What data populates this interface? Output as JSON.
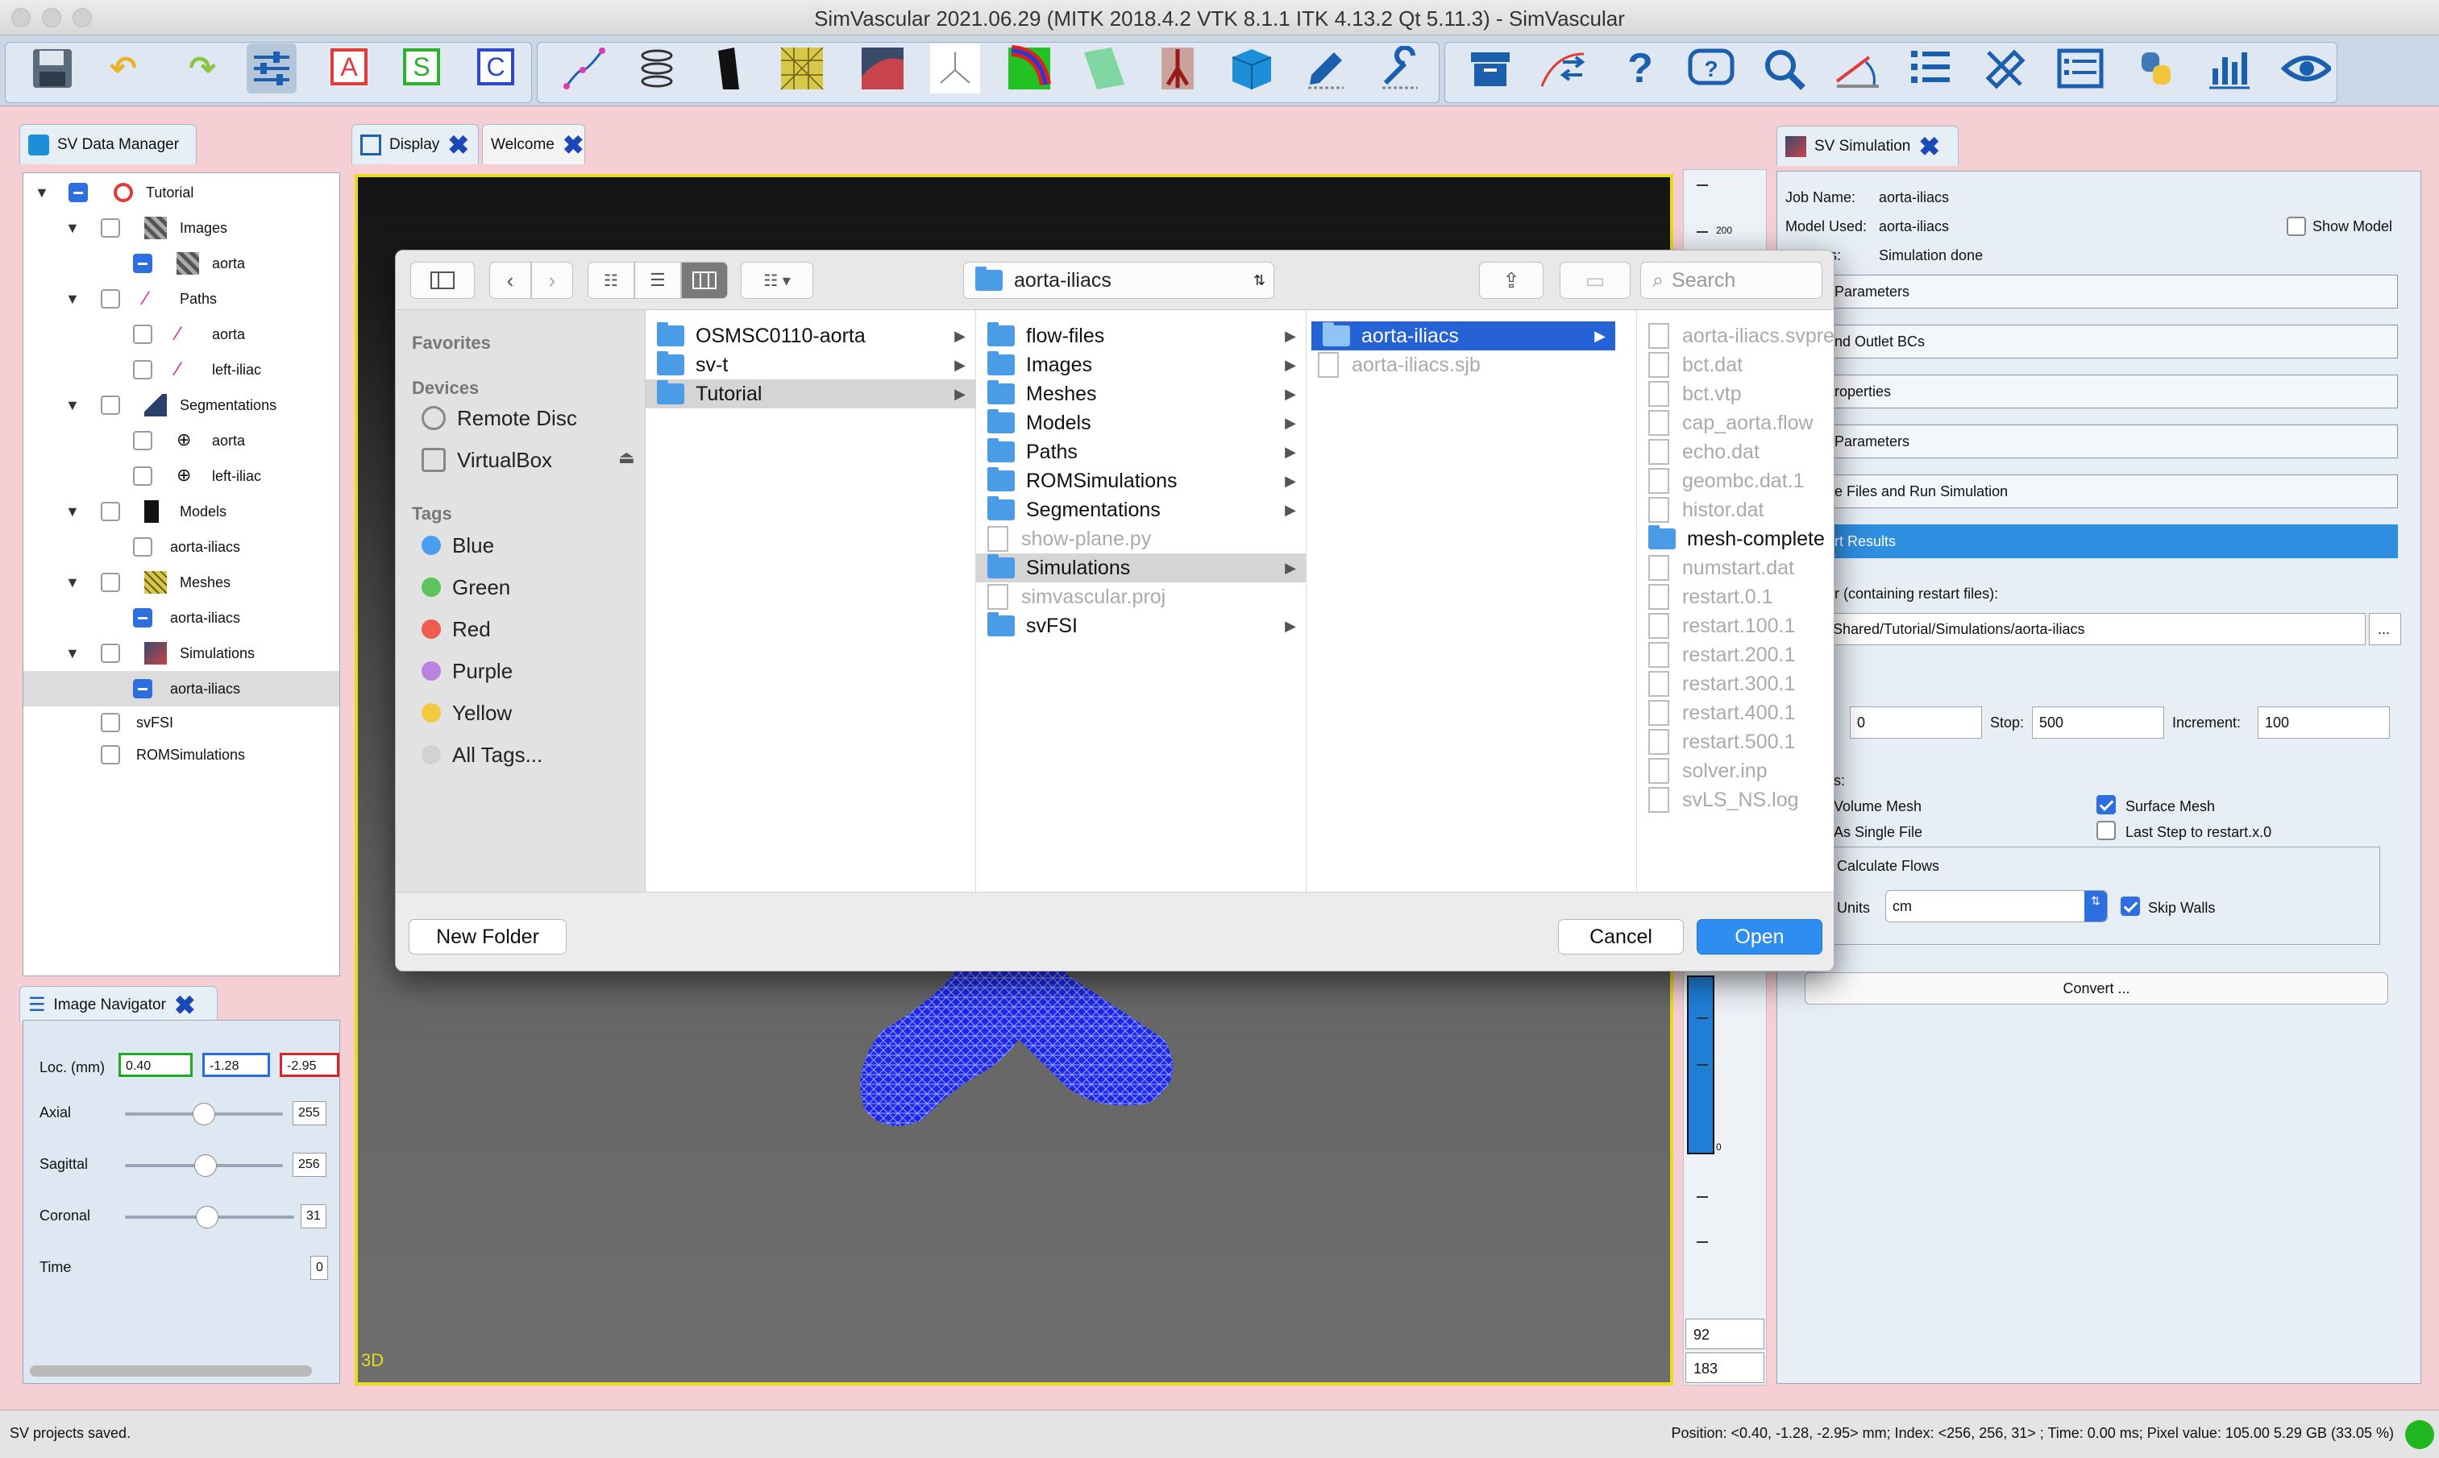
{
  "window": {
    "title": "SimVascular 2021.06.29 (MITK 2018.4.2 VTK 8.1.1 ITK 4.13.2 Qt 5.11.3) - SimVascular"
  },
  "toolbar": {
    "icons": [
      "save-icon",
      "undo-icon",
      "redo-icon",
      "sliders-icon",
      "annotation-a-icon",
      "annotation-s-icon",
      "annotation-c-icon",
      "path-icon",
      "segmentation-icon",
      "model-icon",
      "mesh-icon",
      "image-icon",
      "axes-icon",
      "vessel-icon",
      "surface-icon",
      "anatomy-icon",
      "data-cube-icon",
      "edit-icon",
      "tool-icon",
      "archive-icon",
      "transfer-icon",
      "help-icon",
      "faq-icon",
      "zoom-icon",
      "measure-icon",
      "list-icon",
      "ruler-icon",
      "view-list-icon",
      "python-icon",
      "chart-icon",
      "eye-icon"
    ],
    "text_buttons": [
      "A",
      "S",
      "C"
    ],
    "help_glyph": "?"
  },
  "data_manager": {
    "tab_label": "SV Data Manager",
    "tree": [
      {
        "label": "Tutorial"
      },
      {
        "label": "Images"
      },
      {
        "label": "aorta"
      },
      {
        "label": "Paths"
      },
      {
        "label": "aorta"
      },
      {
        "label": "left-iliac"
      },
      {
        "label": "Segmentations"
      },
      {
        "label": "aorta"
      },
      {
        "label": "left-iliac"
      },
      {
        "label": "Models"
      },
      {
        "label": "aorta-iliacs"
      },
      {
        "label": "Meshes"
      },
      {
        "label": "aorta-iliacs"
      },
      {
        "label": "Simulations"
      },
      {
        "label": "aorta-iliacs"
      },
      {
        "label": "svFSI"
      },
      {
        "label": "ROMSimulations"
      }
    ]
  },
  "image_navigator": {
    "tab_label": "Image Navigator",
    "loc_label": "Loc. (mm)",
    "loc_values": [
      "0.40",
      "-1.28",
      "-2.95"
    ],
    "rows": [
      {
        "label": "Axial",
        "value": "255",
        "fraction": 0.5
      },
      {
        "label": "Sagittal",
        "value": "256",
        "fraction": 0.5
      },
      {
        "label": "Coronal",
        "value": "31",
        "fraction": 0.5
      },
      {
        "label": "Time",
        "value": "0"
      }
    ]
  },
  "display": {
    "tabs": [
      "Display",
      "Welcome"
    ],
    "view_label": "3D"
  },
  "colorbar": {
    "top_tick": "200",
    "bottom_tick": "0",
    "values": [
      "92",
      "183"
    ]
  },
  "simulation": {
    "tab_label": "SV Simulation",
    "job_name_label": "Job Name:",
    "job_name": "aorta-iliacs",
    "model_used_label": "Model Used:",
    "model_used": "aorta-iliacs",
    "status_label": "tus:",
    "status": "Simulation done",
    "show_model_label": "Show Model",
    "sections": [
      "Parameters",
      "nd Outlet BCs",
      "roperties",
      "Parameters",
      "e Files and Run Simulation",
      "rt Results"
    ],
    "result_dir_label": "lt Dir (containing restart files):",
    "result_dir": "ers/Shared/Tutorial/Simulations/aorta-iliacs",
    "browse_label": "...",
    "steps_label": "s:",
    "start_label": ":",
    "start": "0",
    "stop_label": "Stop:",
    "stop": "500",
    "increment_label": "Increment:",
    "increment": "100",
    "options_label": "ons:",
    "volume_mesh_label": "Volume Mesh",
    "surface_mesh_label": "Surface Mesh",
    "single_file_label": "As Single File",
    "last_step_label": "Last Step to restart.x.0",
    "calc_flows_label": "Calculate Flows",
    "units_label": "Units",
    "units": "cm",
    "skip_walls_label": "Skip Walls",
    "convert_label": "Convert ..."
  },
  "file_dialog": {
    "location": "aorta-iliacs",
    "search_placeholder": "Search",
    "sidebar": {
      "favorites_header": "Favorites",
      "devices_header": "Devices",
      "devices": [
        "Remote Disc",
        "VirtualBox"
      ],
      "tags_header": "Tags",
      "tags": [
        {
          "label": "Blue",
          "color": "#4a9ff0"
        },
        {
          "label": "Green",
          "color": "#5cc45a"
        },
        {
          "label": "Red",
          "color": "#ef5c52"
        },
        {
          "label": "Purple",
          "color": "#b884e0"
        },
        {
          "label": "Yellow",
          "color": "#f3ca3e"
        },
        {
          "label": "All Tags...",
          "color": "#d2d2d2"
        }
      ]
    },
    "col1": [
      "OSMSC0110-aorta",
      "sv-t",
      "Tutorial"
    ],
    "col2": [
      "flow-files",
      "Images",
      "Meshes",
      "Models",
      "Paths",
      "ROMSimulations",
      "Segmentations",
      "show-plane.py",
      "Simulations",
      "simvascular.proj",
      "svFSI"
    ],
    "col3": [
      "aorta-iliacs",
      "aorta-iliacs.sjb"
    ],
    "col4": [
      "aorta-iliacs.svpre",
      "bct.dat",
      "bct.vtp",
      "cap_aorta.flow",
      "echo.dat",
      "geombc.dat.1",
      "histor.dat",
      "mesh-complete",
      "numstart.dat",
      "restart.0.1",
      "restart.100.1",
      "restart.200.1",
      "restart.300.1",
      "restart.400.1",
      "restart.500.1",
      "solver.inp",
      "svLS_NS.log"
    ],
    "new_folder_label": "New Folder",
    "cancel_label": "Cancel",
    "open_label": "Open"
  },
  "status_bar": {
    "left": "SV projects saved.",
    "right": "Position: <0.40, -1.28, -2.95> mm; Index: <256, 256, 31> ; Time: 0.00 ms; Pixel value: 105.00   5.29 GB (33.05 %)"
  }
}
